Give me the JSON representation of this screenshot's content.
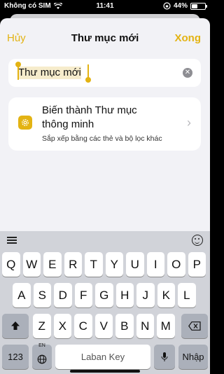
{
  "status_bar": {
    "carrier": "Không có SIM",
    "time": "11:41",
    "battery": "44%",
    "battery_level": 0.44
  },
  "nav": {
    "cancel_label": "Hủy",
    "title": "Thư mục mới",
    "done_label": "Xong"
  },
  "name_field": {
    "value": "Thư mục mới"
  },
  "smart_folder": {
    "title_line1": "Biến thành Thư mục",
    "title_line2": "thông minh",
    "subtitle": "Sắp xếp bằng các thẻ và bộ lọc khác"
  },
  "keyboard": {
    "row1": [
      "Q",
      "W",
      "E",
      "R",
      "T",
      "Y",
      "U",
      "I",
      "O",
      "P"
    ],
    "row2": [
      "A",
      "S",
      "D",
      "F",
      "G",
      "H",
      "J",
      "K",
      "L"
    ],
    "row3": [
      "Z",
      "X",
      "C",
      "V",
      "B",
      "N",
      "M"
    ],
    "numbers_label": "123",
    "lang_label": "EN",
    "space_label": "Laban Key",
    "return_label": "Nhập"
  },
  "colors": {
    "accent": "#e3b313",
    "background": "#f2f2f6",
    "keyboard": "#d1d3d9"
  }
}
